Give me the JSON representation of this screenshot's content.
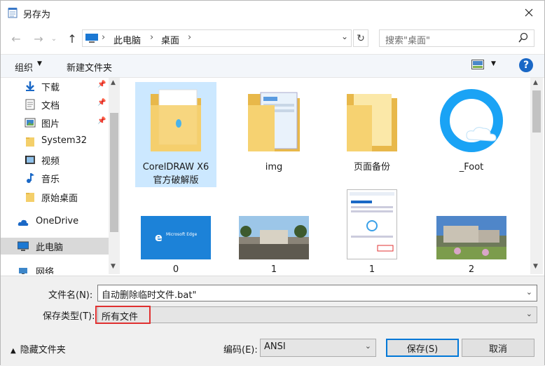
{
  "window": {
    "title": "另存为"
  },
  "nav": {
    "breadcrumbs": [
      "此电脑",
      "桌面"
    ],
    "search_placeholder": "搜索\"桌面\""
  },
  "toolbar": {
    "organize": "组织",
    "new_folder": "新建文件夹"
  },
  "sidebar": {
    "items": [
      {
        "label": "下载",
        "icon": "download-icon",
        "pinned": true
      },
      {
        "label": "文档",
        "icon": "document-icon",
        "pinned": true
      },
      {
        "label": "图片",
        "icon": "picture-icon",
        "pinned": true
      },
      {
        "label": "System32",
        "icon": "folder-icon",
        "pinned": false
      },
      {
        "label": "视频",
        "icon": "video-icon",
        "pinned": false
      },
      {
        "label": "音乐",
        "icon": "music-icon",
        "pinned": false
      },
      {
        "label": "原始桌面",
        "icon": "folder-icon",
        "pinned": false
      },
      {
        "label": "OneDrive",
        "icon": "cloud-icon",
        "pinned": false
      },
      {
        "label": "此电脑",
        "icon": "computer-icon",
        "pinned": false,
        "selected": true
      },
      {
        "label": "网络",
        "icon": "network-icon",
        "pinned": false
      }
    ]
  },
  "files": [
    {
      "name": "CorelDRAW X6 官方破解版",
      "line1": "CorelDRAW X6",
      "line2": "官方破解版",
      "type": "folder",
      "selected": true
    },
    {
      "name": "img",
      "type": "folder"
    },
    {
      "name": "页面备份",
      "type": "folder"
    },
    {
      "name": "_Foot",
      "type": "app"
    },
    {
      "name": "0",
      "type": "image",
      "thumb_text": "Microsoft Edge"
    },
    {
      "name": "1",
      "type": "image"
    },
    {
      "name": "1",
      "type": "image"
    },
    {
      "name": "2",
      "type": "image"
    }
  ],
  "form": {
    "filename_label": "文件名(N):",
    "filename_value": "自动删除临时文件.bat\"",
    "filetype_label": "保存类型(T):",
    "filetype_value": "所有文件",
    "hide_folders": "隐藏文件夹",
    "encoding_label": "编码(E):",
    "encoding_value": "ANSI",
    "save": "保存(S)",
    "cancel": "取消"
  },
  "colors": {
    "accent": "#0078d7",
    "help": "#1a68c6",
    "highlight": "#e03030",
    "selection": "#cce8ff"
  }
}
